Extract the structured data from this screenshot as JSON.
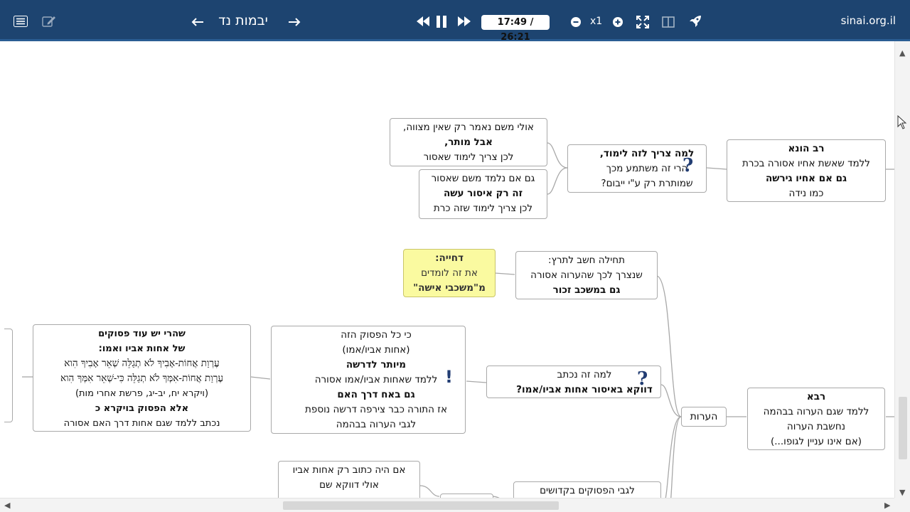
{
  "toolbar": {
    "page_title": "יבמות נד",
    "time": "17:49 / 26:21",
    "speed": "x1",
    "site": "sinai.org.il"
  },
  "nodes": {
    "rav_huna": {
      "line1": "רב הונא",
      "line2": "ללמד שאשת אחיו אסורה בכרת",
      "line3": "גם אם אחיו גירשה",
      "line4": "כמו נידה"
    },
    "lama_tzarich": {
      "line1": "למה צריך לזה לימוד,",
      "line2": "הרי זה משתמע מכך",
      "line3": "שמותרת רק ע\"י ייבום?"
    },
    "ulai": {
      "line1": "אולי משם נאמר רק שאין מצווה,",
      "line2": "אבל מותר,",
      "line3": "לכן צריך לימוד שאסור"
    },
    "gam_im": {
      "line1": "גם אם נלמד משם שאסור",
      "line2": "זה רק איסור עשה",
      "line3": "לכן צריך לימוד שזה כרת"
    },
    "dechiya": {
      "line1": "דחייה:",
      "line2": "את זה לומדים",
      "line3": "מ\"משכבי אישה\""
    },
    "techila": {
      "line1": "תחילה חשב לתרץ:",
      "line2": "שנצרך לכך שהערוה אסורה",
      "line3": "גם במשכב זכור"
    },
    "shehare": {
      "line1": "שהרי יש עוד פסוקים",
      "line2": "של אחות אביו ואמו:",
      "line3": "עֶרְוַת אֲחוֹת-אָבִיךָ לֹא תְגַלֵּה שְׁאֵר אָבִיךָ הִוא",
      "line4": "עֶרְוַת אֲחוֹת-אִמְּךָ לֹא תְגַלֵּה כִּי-שְׁאֵר אִמְּךָ הִוא",
      "line5": "(ויקרא יח, יב-יג, פרשת אחרי מות)",
      "line6": "אלא הפסוק בויקרא כ",
      "line7": "נכתב ללמד שגם אחות דרך האם אסורה"
    },
    "ki_kol": {
      "line1": "כי כל הפסוק הזה",
      "line2": "(אחות אביו/אמו)",
      "line3": "מיותר לדרשה",
      "line4": "ללמד שאחות אביו/אמו אסורה",
      "line5": "גם באח דרך האם",
      "line6": "אז התורה כבר צירפה דרשה נוספת",
      "line7": "לגבי הערוה בבהמה"
    },
    "lama_ze": {
      "line1": "למה זה נכתב",
      "line2": "דווקא באיסור אחות אביו/אמו?"
    },
    "arayot": {
      "label": "הערות"
    },
    "rava": {
      "line1": "רבא",
      "line2": "ללמד שגם הערוה בבהמה",
      "line3": "נחשבת הערוה",
      "line4": "(אם אינו עניין לגופו...)"
    },
    "im_haya": {
      "line1": "אם היה כתוב רק אחות אביו",
      "line2": "אולי דווקא שם",
      "line3": "..."
    },
    "legabei": {
      "line1": "לגבי הפסוקים בקדושים"
    }
  }
}
